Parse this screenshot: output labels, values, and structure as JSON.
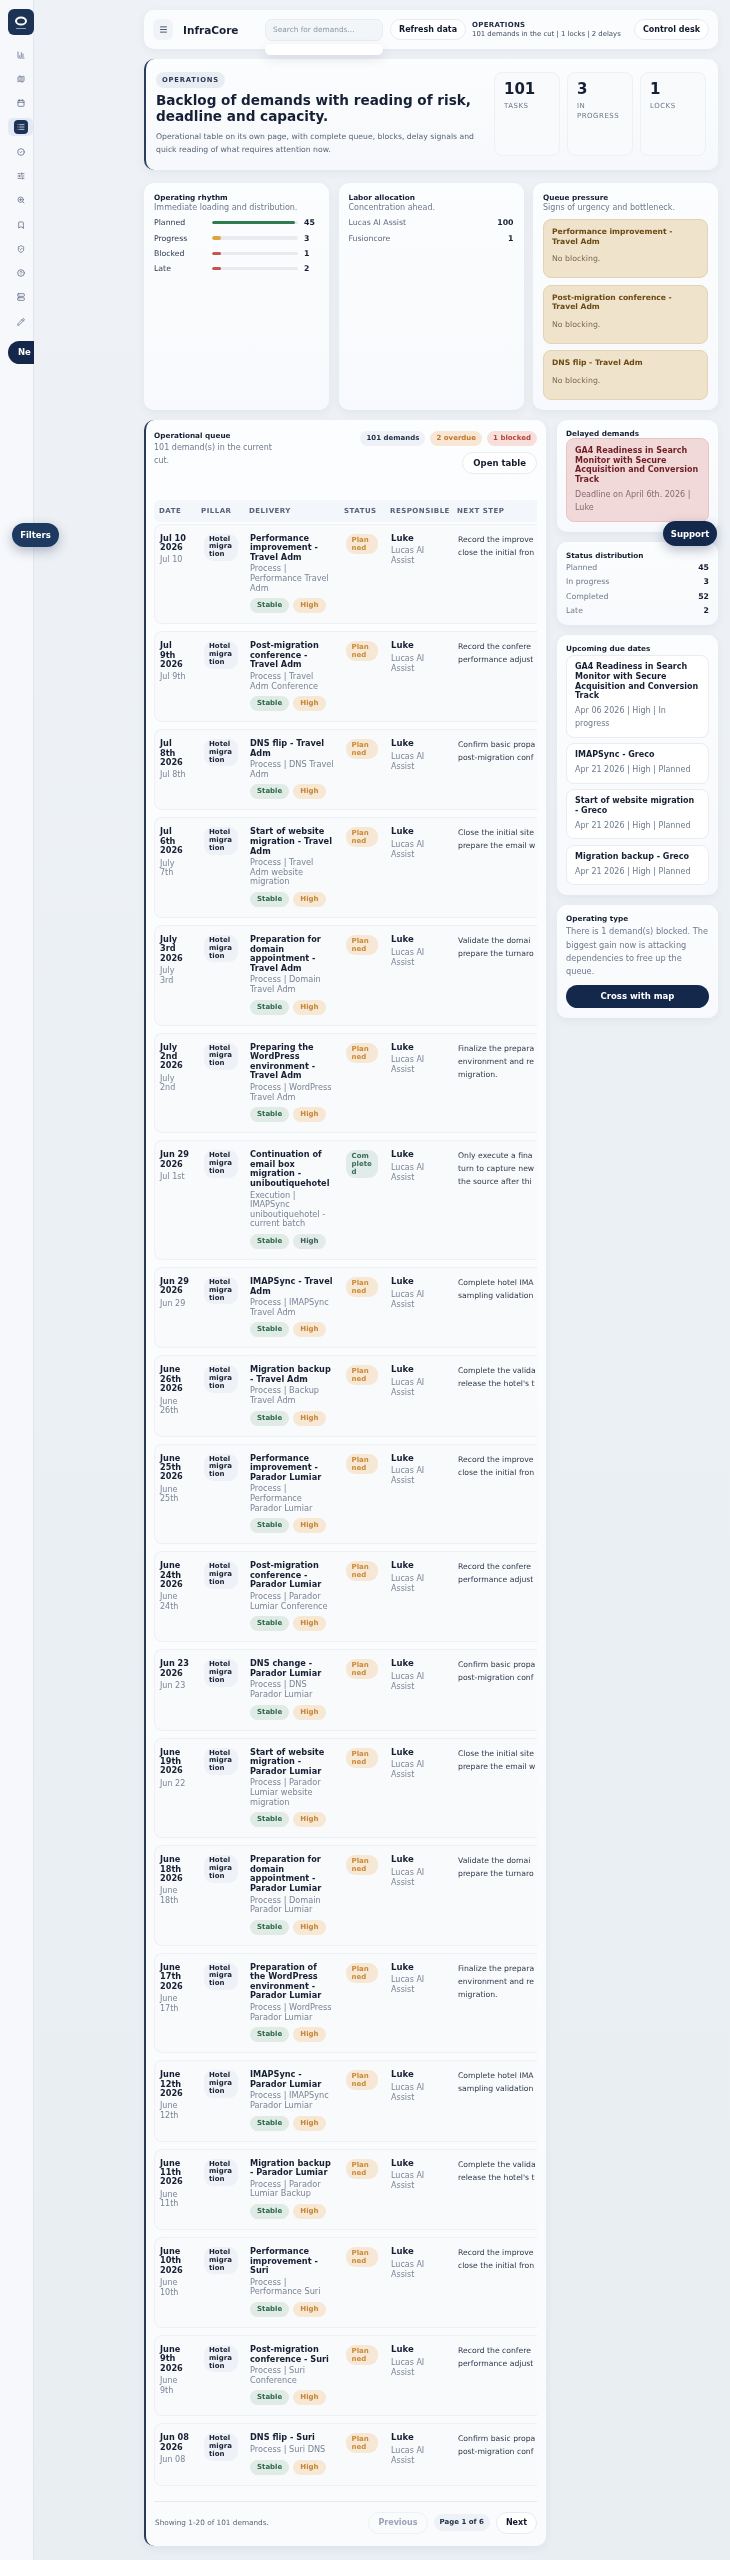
{
  "sidebar": {
    "items": [
      {
        "selected": false
      },
      {
        "selected": false
      },
      {
        "selected": false
      },
      {
        "selected": true
      },
      {
        "selected": false
      },
      {
        "selected": false
      },
      {
        "selected": false
      },
      {
        "selected": false
      },
      {
        "selected": false
      },
      {
        "selected": false
      },
      {
        "selected": false
      },
      {
        "selected": false
      }
    ],
    "new_button": "Ne"
  },
  "header": {
    "title": "InfraCore",
    "search": {
      "placeholder": "Search for demands..."
    },
    "refresh_button": "Refresh data",
    "context": {
      "label": "OPERATIONS",
      "summary": "101 demands in the cut | 1 locks | 2 delays"
    },
    "control_button": "Control desk"
  },
  "hero": {
    "badge": "OPERATIONS",
    "title": "Backlog of demands with reading of risk, deadline and capacity.",
    "description": "Operational table on its own page, with complete queue, blocks, delay signals and quick reading of what requires attention now.",
    "stats": [
      {
        "value": "101",
        "label": "TASKS"
      },
      {
        "value": "3",
        "label": "IN PROGRESS"
      },
      {
        "value": "1",
        "label": "LOCKS"
      }
    ]
  },
  "rhythm": {
    "title": "Operating rhythm",
    "subtitle": "Immediate loading and distribution.",
    "rows": [
      {
        "label": "Planned",
        "value": "45",
        "level": 0.97,
        "color": "#2f7d4f"
      },
      {
        "label": "Progress",
        "value": "3",
        "level": 0.1,
        "color": "#dfa43c"
      },
      {
        "label": "Blocked",
        "value": "1",
        "level": 0.1,
        "color": "#c9544b"
      },
      {
        "label": "Late",
        "value": "2",
        "level": 0.1,
        "color": "#c9544b"
      }
    ]
  },
  "labor": {
    "title": "Labor allocation",
    "subtitle": "Concentration ahead.",
    "rows": [
      {
        "name": "Lucas AI Assist",
        "value": "100"
      },
      {
        "name": "Fusioncore",
        "value": "1"
      }
    ]
  },
  "queue_pressure": {
    "title": "Queue pressure",
    "subtitle": "Signs of urgency and bottleneck.",
    "items": [
      {
        "title": "Performance improvement - Travel Adm",
        "note": "No blocking."
      },
      {
        "title": "Post-migration conference - Travel Adm",
        "note": "No blocking."
      },
      {
        "title": "DNS flip - Travel Adm",
        "note": "No blocking."
      }
    ]
  },
  "queue": {
    "title": "Operational queue",
    "subtitle": "101 demand(s) in the current cut.",
    "pills": [
      {
        "text": "101 demands",
        "kind": "neutral"
      },
      {
        "text": "2 overdue",
        "kind": "warning"
      },
      {
        "text": "1 blocked",
        "kind": "danger"
      }
    ],
    "open_button": "Open table",
    "columns": [
      "DATE",
      "PILLAR",
      "DELIVERY",
      "STATUS",
      "RESPONSIBLE",
      "NEXT STEP"
    ],
    "rows": [
      {
        "date": "Jul 10 2026",
        "date_note": "Jul 10",
        "pillar": "Hotel migration",
        "title": "Performance improvement - Travel Adm",
        "detail": "Process | Performance Travel Adm",
        "tags": [
          {
            "text": "Stable",
            "kind": "stable"
          },
          {
            "text": "High",
            "kind": "high"
          }
        ],
        "status": {
          "text": "Planned",
          "kind": "planned"
        },
        "owner": "Luke",
        "team": "Lucas AI Assist",
        "next_step": [
          "Record the improve",
          "close the initial fron"
        ]
      },
      {
        "date": "Jul 9th 2026",
        "date_note": "Jul 9th",
        "pillar": "Hotel migration",
        "title": "Post-migration conference - Travel Adm",
        "detail": "Process | Travel Adm Conference",
        "tags": [
          {
            "text": "Stable",
            "kind": "stable"
          },
          {
            "text": "High",
            "kind": "high"
          }
        ],
        "status": {
          "text": "Planned",
          "kind": "planned"
        },
        "owner": "Luke",
        "team": "Lucas AI Assist",
        "next_step": [
          "Record the confere",
          "performance adjust"
        ]
      },
      {
        "date": "Jul 8th 2026",
        "date_note": "Jul 8th",
        "pillar": "Hotel migration",
        "title": "DNS flip - Travel Adm",
        "detail": "Process | DNS Travel Adm",
        "tags": [
          {
            "text": "Stable",
            "kind": "stable"
          },
          {
            "text": "High",
            "kind": "high"
          }
        ],
        "status": {
          "text": "Planned",
          "kind": "planned"
        },
        "owner": "Luke",
        "team": "Lucas AI Assist",
        "next_step": [
          "Confirm basic propa",
          "post-migration conf"
        ]
      },
      {
        "date": "Jul 6th 2026",
        "date_note": "July 7th",
        "pillar": "Hotel migration",
        "title": "Start of website migration - Travel Adm",
        "detail": "Process | Travel Adm website migration",
        "tags": [
          {
            "text": "Stable",
            "kind": "stable"
          },
          {
            "text": "High",
            "kind": "high"
          }
        ],
        "status": {
          "text": "Planned",
          "kind": "planned"
        },
        "owner": "Luke",
        "team": "Lucas AI Assist",
        "next_step": [
          "Close the initial site",
          "prepare the email w"
        ]
      },
      {
        "date": "July 3rd 2026",
        "date_note": "July 3rd",
        "pillar": "Hotel migration",
        "title": "Preparation for domain appointment - Travel Adm",
        "detail": "Process | Domain Travel Adm",
        "tags": [
          {
            "text": "Stable",
            "kind": "stable"
          },
          {
            "text": "High",
            "kind": "high"
          }
        ],
        "status": {
          "text": "Planned",
          "kind": "planned"
        },
        "owner": "Luke",
        "team": "Lucas AI Assist",
        "next_step": [
          "Validate the domai",
          "prepare the turnaro"
        ]
      },
      {
        "date": "July 2nd 2026",
        "date_note": "July 2nd",
        "pillar": "Hotel migration",
        "title": "Preparing the WordPress environment - Travel Adm",
        "detail": "Process | WordPress Travel Adm",
        "tags": [
          {
            "text": "Stable",
            "kind": "stable"
          },
          {
            "text": "High",
            "kind": "high"
          }
        ],
        "status": {
          "text": "Planned",
          "kind": "planned"
        },
        "owner": "Luke",
        "team": "Lucas AI Assist",
        "next_step": [
          "Finalize the prepara",
          "environment and re",
          "migration."
        ]
      },
      {
        "date": "Jun 29 2026",
        "date_note": "Jul 1st",
        "pillar": "Hotel migration",
        "title": "Continuation of email box migration - uniboutiquehotel",
        "detail": "Execution | IMAPSync uniboutiquehotel - current batch",
        "tags": [
          {
            "text": "Stable",
            "kind": "stable"
          },
          {
            "text": "High",
            "kind": "neutral"
          }
        ],
        "status": {
          "text": "Completed",
          "kind": "completed"
        },
        "owner": "Luke",
        "team": "Lucas AI Assist",
        "next_step": [
          "Only execute a fina",
          "turn to capture new",
          "the source after thi"
        ]
      },
      {
        "date": "Jun 29 2026",
        "date_note": "Jun 29",
        "pillar": "Hotel migration",
        "title": "IMAPSync - Travel Adm",
        "detail": "Process | IMAPSync Travel Adm",
        "tags": [
          {
            "text": "Stable",
            "kind": "stable"
          },
          {
            "text": "High",
            "kind": "high"
          }
        ],
        "status": {
          "text": "Planned",
          "kind": "planned"
        },
        "owner": "Luke",
        "team": "Lucas AI Assist",
        "next_step": [
          "Complete hotel IMA",
          "sampling validation"
        ]
      },
      {
        "date": "June 26th 2026",
        "date_note": "June 26th",
        "pillar": "Hotel migration",
        "title": "Migration backup - Travel Adm",
        "detail": "Process | Backup Travel Adm",
        "tags": [
          {
            "text": "Stable",
            "kind": "stable"
          },
          {
            "text": "High",
            "kind": "high"
          }
        ],
        "status": {
          "text": "Planned",
          "kind": "planned"
        },
        "owner": "Luke",
        "team": "Lucas AI Assist",
        "next_step": [
          "Complete the valida",
          "release the hotel's t"
        ]
      },
      {
        "date": "June 25th 2026",
        "date_note": "June 25th",
        "pillar": "Hotel migration",
        "title": "Performance improvement - Parador Lumiar",
        "detail": "Process | Performance Parador Lumiar",
        "tags": [
          {
            "text": "Stable",
            "kind": "stable"
          },
          {
            "text": "High",
            "kind": "high"
          }
        ],
        "status": {
          "text": "Planned",
          "kind": "planned"
        },
        "owner": "Luke",
        "team": "Lucas AI Assist",
        "next_step": [
          "Record the improve",
          "close the initial fron"
        ]
      },
      {
        "date": "June 24th 2026",
        "date_note": "June 24th",
        "pillar": "Hotel migration",
        "title": "Post-migration conference - Parador Lumiar",
        "detail": "Process | Parador Lumiar Conference",
        "tags": [
          {
            "text": "Stable",
            "kind": "stable"
          },
          {
            "text": "High",
            "kind": "high"
          }
        ],
        "status": {
          "text": "Planned",
          "kind": "planned"
        },
        "owner": "Luke",
        "team": "Lucas AI Assist",
        "next_step": [
          "Record the confere",
          "performance adjust"
        ]
      },
      {
        "date": "Jun 23 2026",
        "date_note": "Jun 23",
        "pillar": "Hotel migration",
        "title": "DNS change - Parador Lumiar",
        "detail": "Process | DNS Parador Lumiar",
        "tags": [
          {
            "text": "Stable",
            "kind": "stable"
          },
          {
            "text": "High",
            "kind": "high"
          }
        ],
        "status": {
          "text": "Planned",
          "kind": "planned"
        },
        "owner": "Luke",
        "team": "Lucas AI Assist",
        "next_step": [
          "Confirm basic propa",
          "post-migration conf"
        ]
      },
      {
        "date": "June 19th 2026",
        "date_note": "Jun 22",
        "pillar": "Hotel migration",
        "title": "Start of website migration - Parador Lumiar",
        "detail": "Process | Parador Lumiar website migration",
        "tags": [
          {
            "text": "Stable",
            "kind": "stable"
          },
          {
            "text": "High",
            "kind": "high"
          }
        ],
        "status": {
          "text": "Planned",
          "kind": "planned"
        },
        "owner": "Luke",
        "team": "Lucas AI Assist",
        "next_step": [
          "Close the initial site",
          "prepare the email w"
        ]
      },
      {
        "date": "June 18th 2026",
        "date_note": "June 18th",
        "pillar": "Hotel migration",
        "title": "Preparation for domain appointment - Parador Lumiar",
        "detail": "Process | Domain Parador Lumiar",
        "tags": [
          {
            "text": "Stable",
            "kind": "stable"
          },
          {
            "text": "High",
            "kind": "high"
          }
        ],
        "status": {
          "text": "Planned",
          "kind": "planned"
        },
        "owner": "Luke",
        "team": "Lucas AI Assist",
        "next_step": [
          "Validate the domai",
          "prepare the turnaro"
        ]
      },
      {
        "date": "June 17th 2026",
        "date_note": "June 17th",
        "pillar": "Hotel migration",
        "title": "Preparation of the WordPress environment - Parador Lumiar",
        "detail": "Process | WordPress Parador Lumiar",
        "tags": [
          {
            "text": "Stable",
            "kind": "stable"
          },
          {
            "text": "High",
            "kind": "high"
          }
        ],
        "status": {
          "text": "Planned",
          "kind": "planned"
        },
        "owner": "Luke",
        "team": "Lucas AI Assist",
        "next_step": [
          "Finalize the prepara",
          "environment and re",
          "migration."
        ]
      },
      {
        "date": "June 12th 2026",
        "date_note": "June 12th",
        "pillar": "Hotel migration",
        "title": "IMAPSync - Parador Lumiar",
        "detail": "Process | IMAPSync Parador Lumiar",
        "tags": [
          {
            "text": "Stable",
            "kind": "stable"
          },
          {
            "text": "High",
            "kind": "high"
          }
        ],
        "status": {
          "text": "Planned",
          "kind": "planned"
        },
        "owner": "Luke",
        "team": "Lucas AI Assist",
        "next_step": [
          "Complete hotel IMA",
          "sampling validation"
        ]
      },
      {
        "date": "June 11th 2026",
        "date_note": "June 11th",
        "pillar": "Hotel migration",
        "title": "Migration backup - Parador Lumiar",
        "detail": "Process | Parador Lumiar Backup",
        "tags": [
          {
            "text": "Stable",
            "kind": "stable"
          },
          {
            "text": "High",
            "kind": "high"
          }
        ],
        "status": {
          "text": "Planned",
          "kind": "planned"
        },
        "owner": "Luke",
        "team": "Lucas AI Assist",
        "next_step": [
          "Complete the valida",
          "release the hotel's t"
        ]
      },
      {
        "date": "June 10th 2026",
        "date_note": "June 10th",
        "pillar": "Hotel migration",
        "title": "Performance improvement - Suri",
        "detail": "Process | Performance Suri",
        "tags": [
          {
            "text": "Stable",
            "kind": "stable"
          },
          {
            "text": "High",
            "kind": "high"
          }
        ],
        "status": {
          "text": "Planned",
          "kind": "planned"
        },
        "owner": "Luke",
        "team": "Lucas AI Assist",
        "next_step": [
          "Record the improve",
          "close the initial fron"
        ]
      },
      {
        "date": "June 9th 2026",
        "date_note": "June 9th",
        "pillar": "Hotel migration",
        "title": "Post-migration conference - Suri",
        "detail": "Process | Suri Conference",
        "tags": [
          {
            "text": "Stable",
            "kind": "stable"
          },
          {
            "text": "High",
            "kind": "high"
          }
        ],
        "status": {
          "text": "Planned",
          "kind": "planned"
        },
        "owner": "Luke",
        "team": "Lucas AI Assist",
        "next_step": [
          "Record the confere",
          "performance adjust"
        ]
      },
      {
        "date": "Jun 08 2026",
        "date_note": "Jun 08",
        "pillar": "Hotel migration",
        "title": "DNS flip - Suri",
        "detail": "Process | Suri DNS",
        "tags": [
          {
            "text": "Stable",
            "kind": "stable"
          },
          {
            "text": "High",
            "kind": "high"
          }
        ],
        "status": {
          "text": "Planned",
          "kind": "planned"
        },
        "owner": "Luke",
        "team": "Lucas AI Assist",
        "next_step": [
          "Confirm basic propa",
          "post-migration conf"
        ]
      }
    ],
    "footer": {
      "summary": "Showing 1-20 of 101 demands.",
      "previous": {
        "label": "Previous",
        "disabled": true
      },
      "page": "Page 1 of 6",
      "next": {
        "label": "Next",
        "disabled": false
      }
    }
  },
  "delayed": {
    "title": "Delayed demands",
    "items": [
      {
        "title": "GA4 Readiness in Search Monitor with Secure Acquisition and Conversion Track",
        "meta": "Deadline on April 6th. 2026 | Luke"
      }
    ]
  },
  "status_distribution": {
    "title": "Status distribution",
    "rows": [
      {
        "label": "Planned",
        "value": "45"
      },
      {
        "label": "In progress",
        "value": "3"
      },
      {
        "label": "Completed",
        "value": "52"
      },
      {
        "label": "Late",
        "value": "2"
      }
    ]
  },
  "upcoming": {
    "title": "Upcoming due dates",
    "items": [
      {
        "title": "GA4 Readiness in Search Monitor with Secure Acquisition and Conversion Track",
        "meta": "Apr 06 2026 | High | In progress"
      },
      {
        "title": "IMAPSync - Greco",
        "meta": "Apr 21 2026 | High | Planned"
      },
      {
        "title": "Start of website migration - Greco",
        "meta": "Apr 21 2026 | High | Planned"
      },
      {
        "title": "Migration backup - Greco",
        "meta": "Apr 21 2026 | High | Planned"
      }
    ]
  },
  "operating_type": {
    "title": "Operating type",
    "text": "There is 1 demand(s) blocked. The biggest gain now is attacking dependencies to free up the queue.",
    "button": "Cross with map"
  },
  "floating": {
    "filters": "Filters",
    "support": "Support"
  }
}
